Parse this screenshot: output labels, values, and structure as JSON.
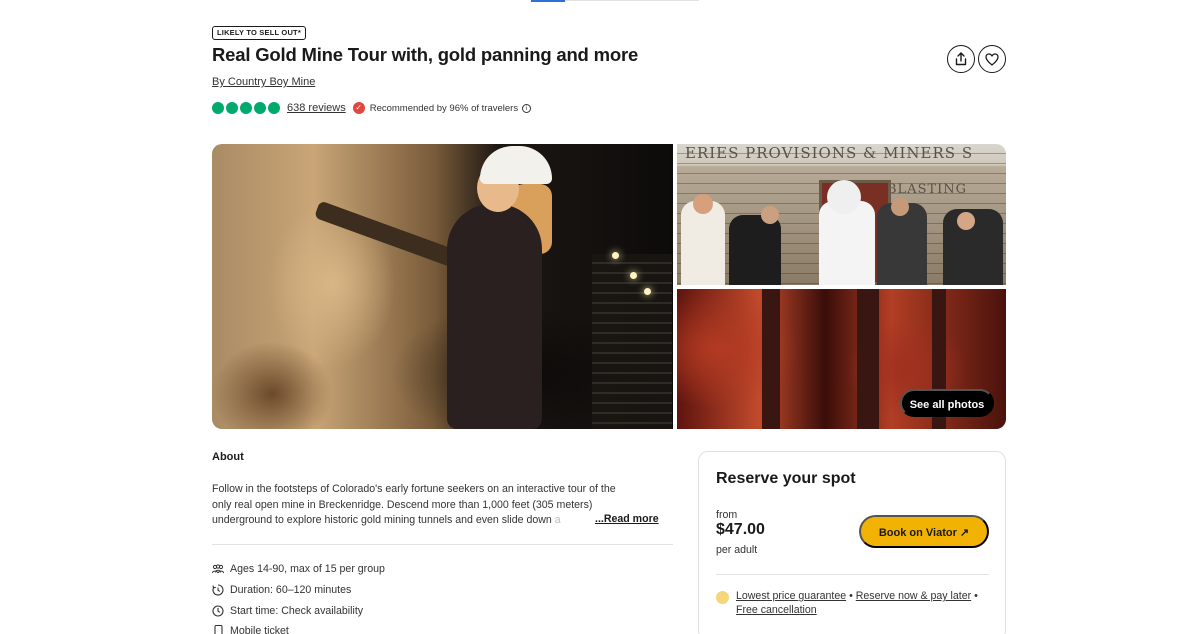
{
  "badge": "LIKELY TO SELL OUT*",
  "title": "Real Gold Mine Tour with, gold panning and more",
  "operator": "By Country Boy Mine",
  "rating": {
    "bubbles": 5,
    "reviews": "638 reviews",
    "recommended": "Recommended by 96% of travelers"
  },
  "actions": {
    "share_icon": "share-icon",
    "save_icon": "heart-icon"
  },
  "gallery": {
    "sign_text": "ERIES PROVISIONS & MINERS S",
    "sign_text_2": "BLASTING",
    "see_all": "See all photos"
  },
  "about": {
    "heading": "About",
    "lines": [
      "Follow in the footsteps of Colorado's early fortune seekers on an interactive tour of the",
      "only real open mine in Breckenridge. Descend more than 1,000 feet (305 meters)",
      "underground to explore historic gold mining tunnels and even slide down"
    ],
    "fade": "a",
    "read_more": "...Read more"
  },
  "features": [
    {
      "icon": "group-icon",
      "text": "Ages 14-90, max of 15 per group"
    },
    {
      "icon": "timer-icon",
      "text": "Duration: 60–120 minutes"
    },
    {
      "icon": "clock-icon",
      "text": "Start time: Check availability"
    },
    {
      "icon": "phone-icon",
      "text": "Mobile ticket"
    }
  ],
  "reserve": {
    "title": "Reserve your spot",
    "from": "from",
    "price": "$47.00",
    "per": "per adult",
    "book_label": "Book on Viator ↗",
    "guarantee_1": "Lowest price guarantee",
    "sep_1": " • ",
    "guarantee_2": "Reserve now & pay later",
    "sep_2": " • ",
    "guarantee_3": "Free cancellation"
  },
  "colors": {
    "rating_green": "#00aa6c",
    "book_yellow": "#f2b203",
    "recommend_red": "#e0483f"
  }
}
